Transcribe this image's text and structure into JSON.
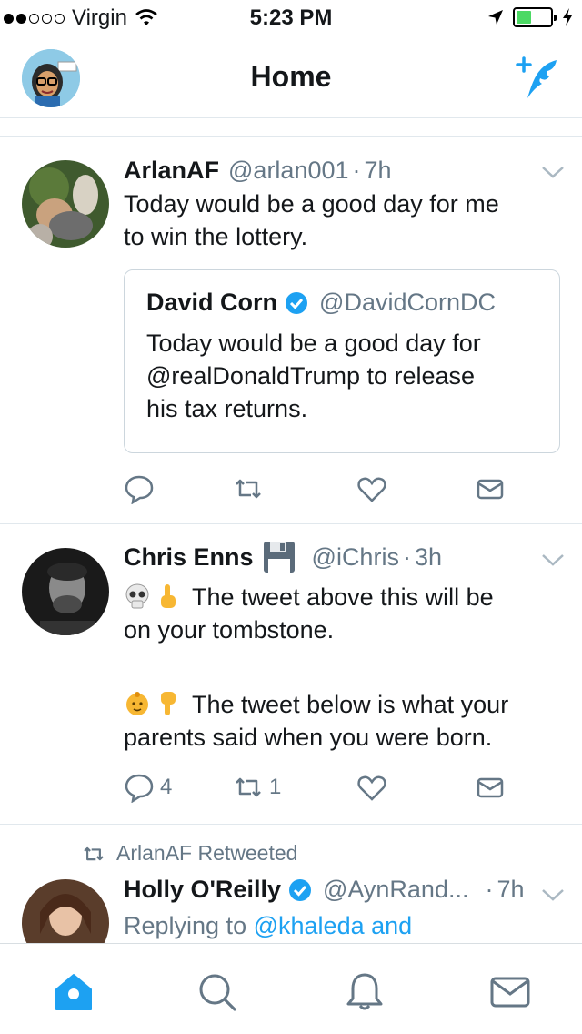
{
  "status_bar": {
    "carrier": "Virgin",
    "time": "5:23 PM",
    "battery_level": 0.45
  },
  "nav": {
    "title": "Home",
    "avatar_icon": "avatar-bitmoji",
    "compose_icon": "compose-tweet-icon"
  },
  "tweets": [
    {
      "name": "ArlanAF",
      "handle": "@arlan001",
      "sep": "·",
      "time": "7h",
      "text_lines": [
        "Today would be a good day for me",
        "to win the lottery."
      ],
      "quote": {
        "name": "David Corn",
        "handle": "@DavidCornDC",
        "text_lines": [
          "Today would be a good day for",
          "@realDonaldTrump to release",
          "his tax returns."
        ]
      },
      "reply_count": "",
      "retweet_count": "",
      "like_count": ""
    },
    {
      "name": "Chris Enns",
      "name_emoji": "floppy-disk-icon",
      "handle": "@iChris",
      "sep": "·",
      "time": "3h",
      "text_lines": [
        " The tweet above this will be",
        "on your tombstone.",
        "",
        " The tweet below is what your",
        "parents said when you were born."
      ],
      "reply_count": "4",
      "retweet_count": "1",
      "like_count": ""
    },
    {
      "retweeted_by": "ArlanAF Retweeted",
      "name": "Holly O'Reilly",
      "handle": "@AynRand...",
      "sep": "·",
      "time": "7h",
      "replying_prefix": "Replying to",
      "replying_to": "@khaleda and"
    }
  ],
  "tab_bar": {
    "items": [
      "home-icon",
      "search-icon",
      "notifications-icon",
      "messages-icon"
    ],
    "active": "home-icon"
  },
  "colors": {
    "accent": "#1da1f2",
    "secondary_text": "#657786",
    "primary_text": "#14171a",
    "border": "#e1e8ed",
    "battery": "#4cd964"
  }
}
